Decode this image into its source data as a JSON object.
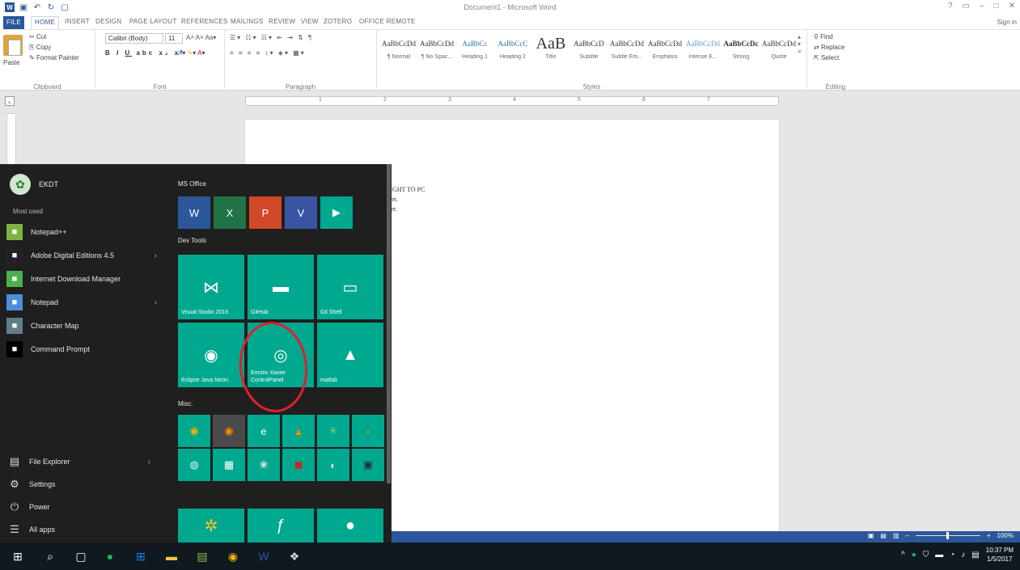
{
  "word": {
    "title": "Document1 - Microsoft Word",
    "signin": "Sign in",
    "tabs": [
      "FILE",
      "HOME",
      "INSERT",
      "DESIGN",
      "PAGE LAYOUT",
      "REFERENCES",
      "MAILINGS",
      "REVIEW",
      "VIEW",
      "ZOTERO",
      "OFFICE REMOTE"
    ],
    "clipboard": {
      "paste": "Paste",
      "cut": "Cut",
      "copy": "Copy",
      "format_painter": "Format Painter",
      "label": "Clipboard"
    },
    "font": {
      "name": "Calibri (Body)",
      "size": "11",
      "label": "Font"
    },
    "paragraph_label": "Paragraph",
    "styles": [
      {
        "sample": "AaBbCcDd",
        "name": "¶ Normal"
      },
      {
        "sample": "AaBbCcDd",
        "name": "¶ No Spac..."
      },
      {
        "sample": "AaBbCc",
        "name": "Heading 1"
      },
      {
        "sample": "AaBbCcC",
        "name": "Heading 2"
      },
      {
        "sample": "AaB",
        "name": "Title"
      },
      {
        "sample": "AaBbCcD",
        "name": "Subtitle"
      },
      {
        "sample": "AaBbCcDd",
        "name": "Subtle Em..."
      },
      {
        "sample": "AaBbCcDd",
        "name": "Emphasis"
      },
      {
        "sample": "AaBbCcDd",
        "name": "Intense E..."
      },
      {
        "sample": "AaBbCcDc",
        "name": "Strong"
      },
      {
        "sample": "AaBbCcDd",
        "name": "Quote"
      }
    ],
    "styles_label": "Styles",
    "editing": {
      "find": "Find",
      "replace": "Replace",
      "select": "Select",
      "label": "Editing"
    },
    "ruler_ticks": [
      "1",
      "2",
      "3",
      "4",
      "5",
      "6",
      "7"
    ],
    "doc_lines": [
      "RIGHT TO PC",
      "dset.",
      "iver."
    ]
  },
  "start_menu": {
    "user": "EKDT",
    "most_used_label": "Most used",
    "most_used": [
      {
        "label": "Notepad++",
        "icon": "notepad-plus-icon",
        "color": "#7cb342",
        "arrow": false
      },
      {
        "label": "Adobe Digital Editions 4.5",
        "icon": "adobe-digital-editions-icon",
        "color": "#222222",
        "arrow": true
      },
      {
        "label": "Internet Download Manager",
        "icon": "idm-icon",
        "color": "#4caf50",
        "arrow": false
      },
      {
        "label": "Notepad",
        "icon": "notepad-icon",
        "color": "#4a90d9",
        "arrow": true
      },
      {
        "label": "Character Map",
        "icon": "character-map-icon",
        "color": "#607d8b",
        "arrow": false
      },
      {
        "label": "Command Prompt",
        "icon": "command-prompt-icon",
        "color": "#000000",
        "arrow": false
      }
    ],
    "bottom": [
      {
        "label": "File Explorer",
        "icon": "folder-icon",
        "glyph": "▤",
        "arrow": true
      },
      {
        "label": "Settings",
        "icon": "gear-icon",
        "glyph": "⚙",
        "arrow": false
      },
      {
        "label": "Power",
        "icon": "power-icon",
        "glyph": "⏻",
        "arrow": false
      },
      {
        "label": "All apps",
        "icon": "all-apps-icon",
        "glyph": "☰",
        "arrow": false
      }
    ],
    "groups": {
      "ms_office": "MS Office",
      "dev_tools": "Dev Tools",
      "misc": "Misc."
    },
    "office_tiles": [
      {
        "letter": "W",
        "name": "word-tile",
        "icon": "word-icon",
        "color": "#2b579a"
      },
      {
        "letter": "X",
        "name": "excel-tile",
        "icon": "excel-icon",
        "color": "#217346"
      },
      {
        "letter": "P",
        "name": "powerpoint-tile",
        "icon": "powerpoint-icon",
        "color": "#d24726"
      },
      {
        "letter": "V",
        "name": "visio-tile",
        "icon": "visio-icon",
        "color": "#3955a3"
      },
      {
        "letter": "▶",
        "name": "media-tile",
        "icon": "media-icon",
        "color": "#00a88f"
      }
    ],
    "dev_tiles": [
      {
        "label": "Visual Studio 2015",
        "icon": "visual-studio-icon",
        "glyph": "⋈",
        "name": "visual-studio-tile"
      },
      {
        "label": "GitHub",
        "icon": "folder-icon",
        "glyph": "▬",
        "name": "github-tile"
      },
      {
        "label": "Git Shell",
        "icon": "git-shell-icon",
        "glyph": "▭",
        "name": "git-shell-tile"
      },
      {
        "label": "Eclipse Java Neon",
        "icon": "eclipse-icon",
        "glyph": "◉",
        "name": "eclipse-tile"
      },
      {
        "label": "Emotiv Xavier ControlPanel",
        "icon": "emotiv-icon",
        "glyph": "◎",
        "name": "emotiv-tile"
      },
      {
        "label": "matlab",
        "icon": "matlab-icon",
        "glyph": "▲",
        "name": "matlab-tile"
      }
    ],
    "misc_tiles": [
      {
        "name": "chrome-tile",
        "icon": "chrome-icon",
        "glyph": "◉",
        "bg": "#00a88f",
        "fg": "#f4b400"
      },
      {
        "name": "firefox-tile",
        "icon": "firefox-icon",
        "glyph": "◉",
        "bg": "#4a4a4a",
        "fg": "#ff8a00"
      },
      {
        "name": "edge-tile",
        "icon": "edge-icon",
        "glyph": "e",
        "bg": "#00a88f",
        "fg": "#ffffff"
      },
      {
        "name": "vlc-tile",
        "icon": "vlc-icon",
        "glyph": "▲",
        "bg": "#00a88f",
        "fg": "#ff8800"
      },
      {
        "name": "app-tile-5",
        "icon": "app-icon",
        "glyph": "✳",
        "bg": "#00a88f",
        "fg": "#9ccc65"
      },
      {
        "name": "app-tile-6",
        "icon": "app-icon",
        "glyph": "●",
        "bg": "#00a88f",
        "fg": "#43a047"
      },
      {
        "name": "app-tile-7",
        "icon": "app-icon",
        "glyph": "◍",
        "bg": "#00a88f",
        "fg": "#e0f2f1"
      },
      {
        "name": "calculator-tile",
        "icon": "calculator-icon",
        "glyph": "▦",
        "bg": "#00a88f",
        "fg": "#ffffff"
      },
      {
        "name": "app-tile-9",
        "icon": "app-icon",
        "glyph": "❀",
        "bg": "#00a88f",
        "fg": "#e0e0e0"
      },
      {
        "name": "acrobat-tile",
        "icon": "acrobat-icon",
        "glyph": "◼",
        "bg": "#00a88f",
        "fg": "#c62828"
      },
      {
        "name": "app-tile-11",
        "icon": "app-icon",
        "glyph": "◐",
        "bg": "#00a88f",
        "fg": "#e0e0e0"
      },
      {
        "name": "app-tile-12",
        "icon": "app-icon",
        "glyph": "▣",
        "bg": "#00a88f",
        "fg": "#263238"
      }
    ],
    "more_tiles": [
      {
        "name": "app-tile-13",
        "icon": "app-icon",
        "glyph": "✲",
        "fg": "#fbc02d"
      },
      {
        "name": "app-tile-14",
        "icon": "app-icon",
        "glyph": "ƒ",
        "fg": "#ffffff"
      },
      {
        "name": "app-tile-15",
        "icon": "app-icon",
        "glyph": "●",
        "fg": "#ffffff"
      }
    ]
  },
  "taskbar": {
    "apps": [
      {
        "name": "start-button",
        "icon": "windows-icon",
        "glyph": "⊞",
        "color": "#ffffff"
      },
      {
        "name": "search-button",
        "icon": "search-icon",
        "glyph": "⌕",
        "color": "#ffffff"
      },
      {
        "name": "task-view-button",
        "icon": "task-view-icon",
        "glyph": "▢",
        "color": "#ffffff"
      },
      {
        "name": "taskbar-app-spotify",
        "icon": "spotify-icon",
        "glyph": "●",
        "color": "#1db954"
      },
      {
        "name": "taskbar-app-store",
        "icon": "store-icon",
        "glyph": "⊞",
        "color": "#0a84ff"
      },
      {
        "name": "taskbar-app-explorer",
        "icon": "folder-icon",
        "glyph": "▬",
        "color": "#f4c542"
      },
      {
        "name": "taskbar-app-notepadpp",
        "icon": "notepad-plus-icon",
        "glyph": "▤",
        "color": "#8bc34a"
      },
      {
        "name": "taskbar-app-chrome",
        "icon": "chrome-icon",
        "glyph": "◉",
        "color": "#f4b400"
      },
      {
        "name": "taskbar-app-word",
        "icon": "word-icon",
        "glyph": "W",
        "color": "#2b579a"
      },
      {
        "name": "taskbar-app-generic",
        "icon": "app-icon",
        "glyph": "❖",
        "color": "#cfd8dc"
      }
    ],
    "time": "10:37 PM",
    "date": "1/5/2017",
    "zoom": "100%"
  }
}
